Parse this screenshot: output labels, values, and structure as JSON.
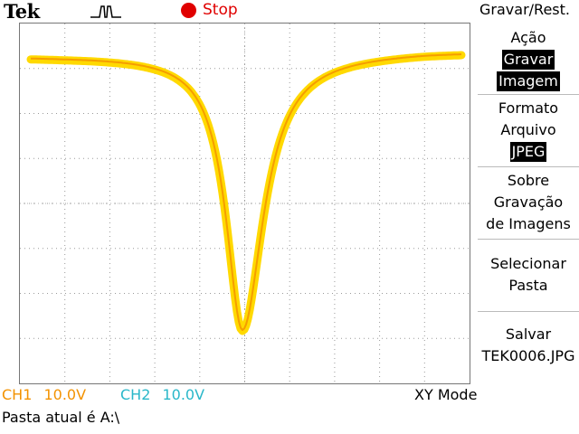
{
  "header": {
    "brand": "Tek",
    "acq_state": "Stop",
    "icons": [
      "trigger-pulse-icon",
      "stop-dot-icon"
    ],
    "stop_color": "#e00000"
  },
  "menu": {
    "title": "Gravar/Rest.",
    "items": [
      {
        "lines": [
          "Ação"
        ],
        "highlight": [
          "Gravar",
          "Imagem"
        ]
      },
      {
        "lines": [
          "Formato",
          "Arquivo"
        ],
        "highlight": [
          "JPEG"
        ]
      },
      {
        "lines": [
          "Sobre",
          "Gravação",
          "de Imagens"
        ]
      },
      {
        "lines": [
          "Selecionar",
          "Pasta"
        ]
      },
      {
        "lines": [
          "Salvar",
          "TEK0006.JPG"
        ]
      }
    ]
  },
  "channels": {
    "ch1": {
      "label": "CH1",
      "scale": "10.0V",
      "color": "#f39200"
    },
    "ch2": {
      "label": "CH2",
      "scale": "10.0V",
      "color": "#29b7c9"
    }
  },
  "mode": "XY Mode",
  "status": "Pasta atual é A:\\",
  "trace_colors": {
    "primary": "#ffd900",
    "secondary": "#f39200"
  }
}
